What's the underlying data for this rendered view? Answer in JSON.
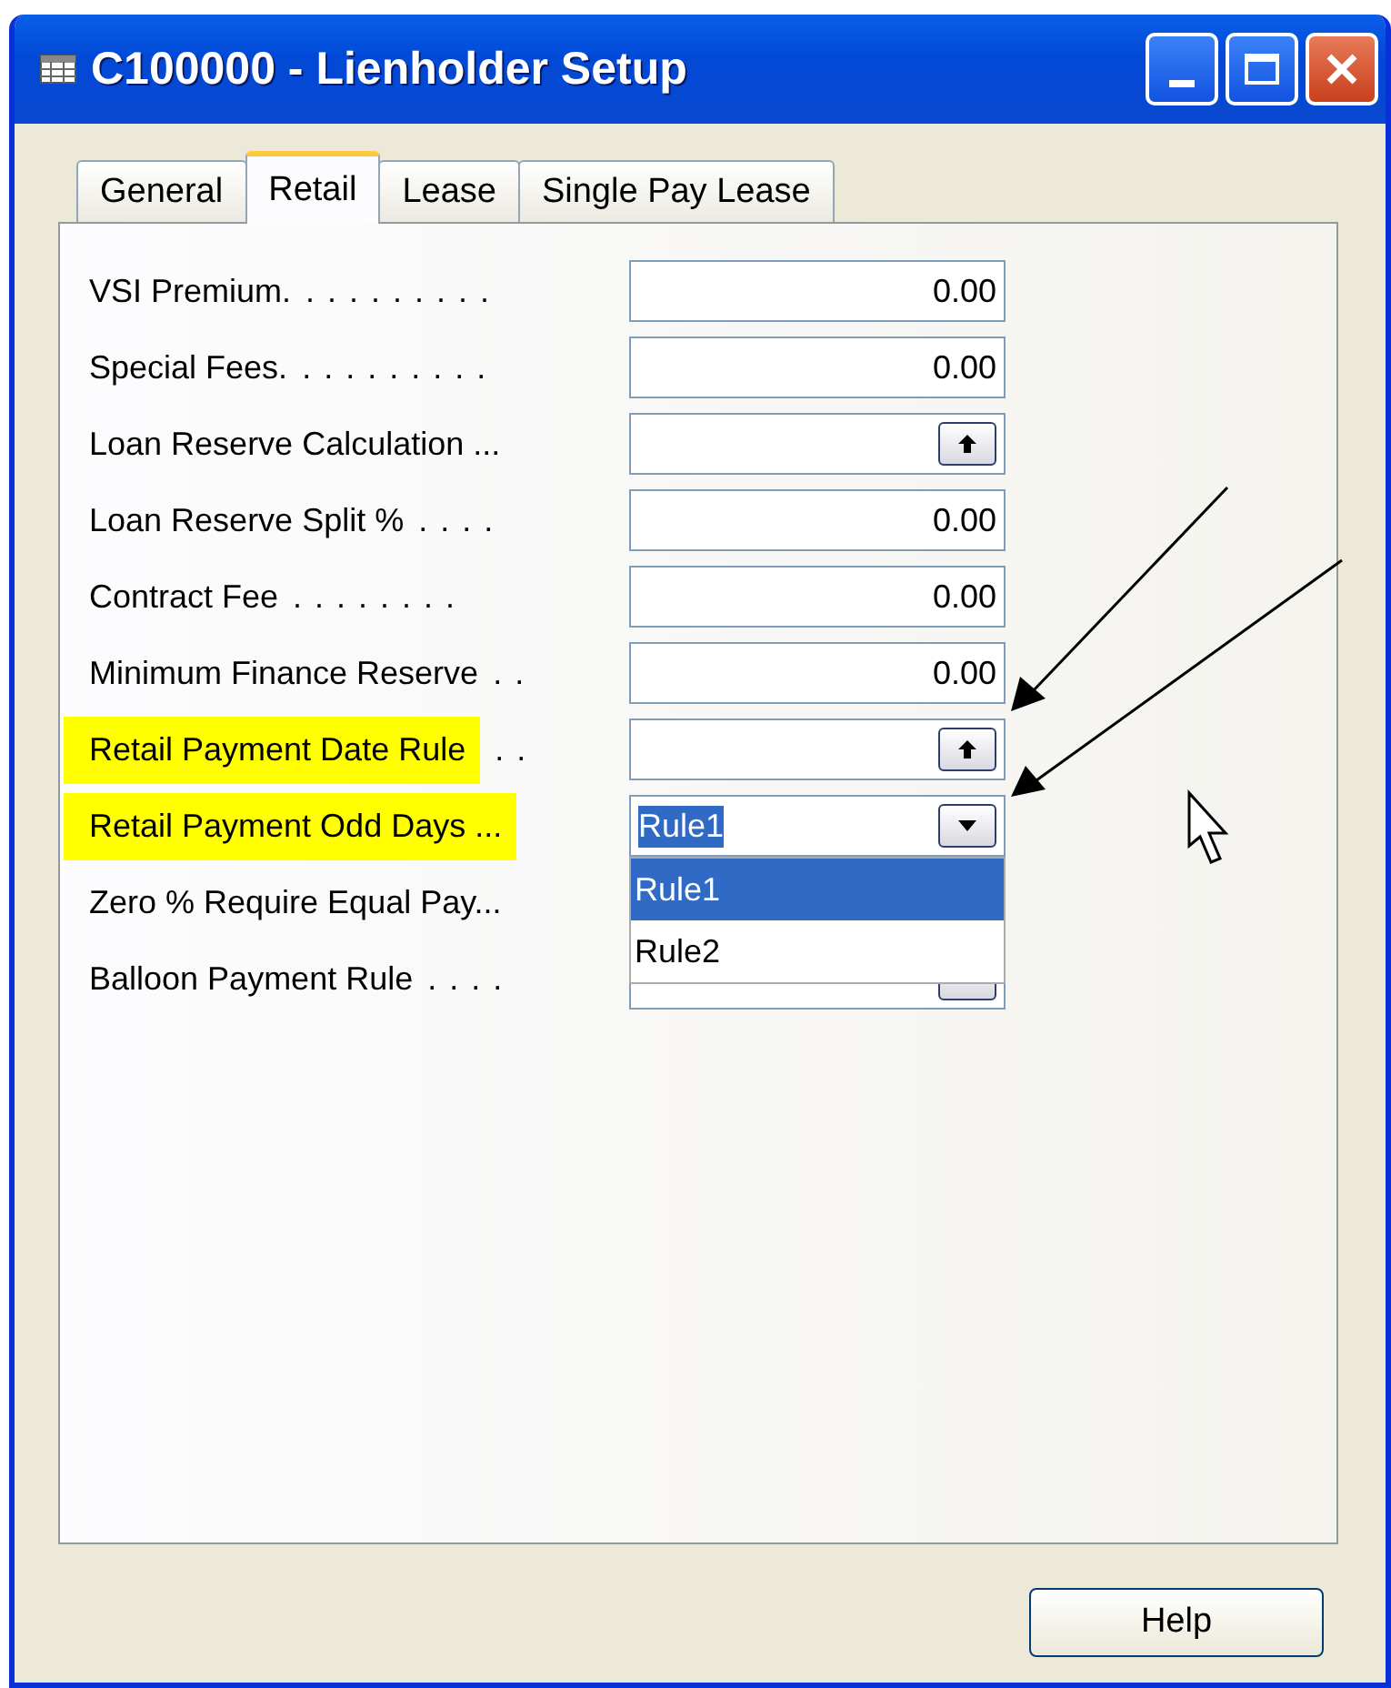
{
  "window": {
    "title": "C100000 - Lienholder Setup"
  },
  "tabs": [
    {
      "label": "General",
      "selected": false
    },
    {
      "label": "Retail",
      "selected": true
    },
    {
      "label": "Lease",
      "selected": false
    },
    {
      "label": "Single Pay Lease",
      "selected": false
    }
  ],
  "fields": [
    {
      "label": "VSI Premium.",
      "leader": ". . . . . . . . .",
      "highlighted": false,
      "kind": "number",
      "value": "0.00"
    },
    {
      "label": "Special Fees.",
      "leader": ". . . . . . . . .",
      "highlighted": false,
      "kind": "number",
      "value": "0.00"
    },
    {
      "label": "Loan Reserve Calculation ...",
      "highlighted": false,
      "kind": "lookup"
    },
    {
      "label": "Loan Reserve Split %",
      "leader": ". . . .",
      "highlighted": false,
      "kind": "number",
      "value": "0.00"
    },
    {
      "label": "Contract Fee",
      "leader": ". . . . . . . .",
      "highlighted": false,
      "kind": "number",
      "value": "0.00"
    },
    {
      "label": "Minimum Finance Reserve",
      "leader": ". .",
      "highlighted": false,
      "kind": "number",
      "value": "0.00"
    },
    {
      "label": "Retail Payment Date Rule",
      "leader": ". .",
      "highlighted": true,
      "kind": "lookup"
    },
    {
      "label": "Retail Payment Odd Days ...",
      "highlighted": true,
      "kind": "dropdown",
      "value": "Rule1",
      "text_selected": true,
      "open": true,
      "options": [
        {
          "label": "Rule1",
          "selected": true
        },
        {
          "label": "Rule2",
          "selected": false
        }
      ]
    },
    {
      "label": "Zero % Require Equal Pay...",
      "highlighted": false
    },
    {
      "label": "Balloon Payment Rule",
      "leader": ". . . .",
      "highlighted": false,
      "kind": "lookup"
    }
  ],
  "buttons": [
    {
      "label": "Help"
    }
  ]
}
